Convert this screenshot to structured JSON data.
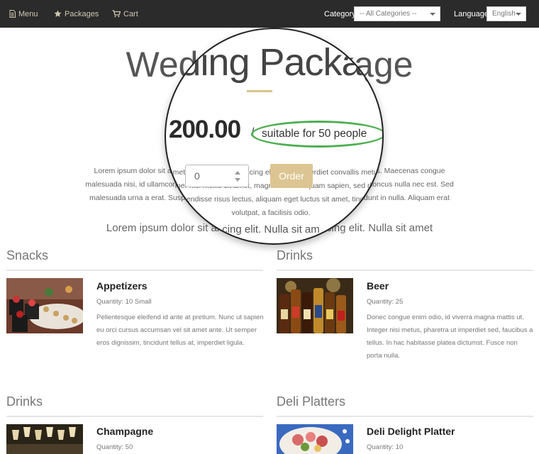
{
  "nav": {
    "menu_label": "Menu",
    "packages_label": "Packages",
    "cart_label": "Cart",
    "category_label": "Category",
    "category_value": "-- All Categories --",
    "language_label": "Language",
    "language_value": "English"
  },
  "background": {
    "title": "Wedding Package",
    "description": "Lorem ipsum dolor sit amet, consectetur adipiscing elit. Nulla imperdiet convallis metus. Maecenas congue malesuada nisi, id ullamcorper nisl mollis sit amet, magna libero aliquam sapien, sed rhoncus nulla nec est. Sed malesuada urna a erat. Suspendisse risus lectus, aliquam eget luctus sit amet, tincidunt in nulla. Aliquam erat volutpat, a facilisis odio.",
    "tail_text": "Lorem ipsum dolor sit amet, consectetur adipiscing elit. Nulla sit amet"
  },
  "magnifier": {
    "title_fragment": "dding Packag",
    "price": "200.00",
    "separator": "/",
    "suitable_text": "suitable for 50 people",
    "quantity_value": "0",
    "order_label": "Order",
    "tail_fragment": "cing elit. Nulla sit am"
  },
  "sections": [
    {
      "heading": "Snacks",
      "item": {
        "name": "Appetizers",
        "quantity": "Quantity: 10 Small",
        "description": "Pellentesque eleifend id ante at pretium. Nunc ut sapien eu orci cursus accumsan vel sit amet ante. Ut semper eros dignissim, tincidunt tellus at, imperdiet ligula."
      }
    },
    {
      "heading": "Drinks",
      "item": {
        "name": "Beer",
        "quantity": "Quantity: 25",
        "description": "Donec congue enim odio, id viverra magna mattis ut. Integer nisi metus, pharetra ut imperdiet sed, faucibus a tellus. In hac habitasse platea dictumst. Fusce non porta nulla."
      }
    },
    {
      "heading": "Drinks",
      "item": {
        "name": "Champagne",
        "quantity": "Quantity: 50"
      }
    },
    {
      "heading": "Deli Platters",
      "item": {
        "name": "Deli Delight Platter",
        "quantity": "Quantity: 10"
      }
    }
  ],
  "colors": {
    "navbar_bg": "#2b2b2b",
    "accent_gold": "#dcc592",
    "highlight_green": "#4caf50"
  }
}
